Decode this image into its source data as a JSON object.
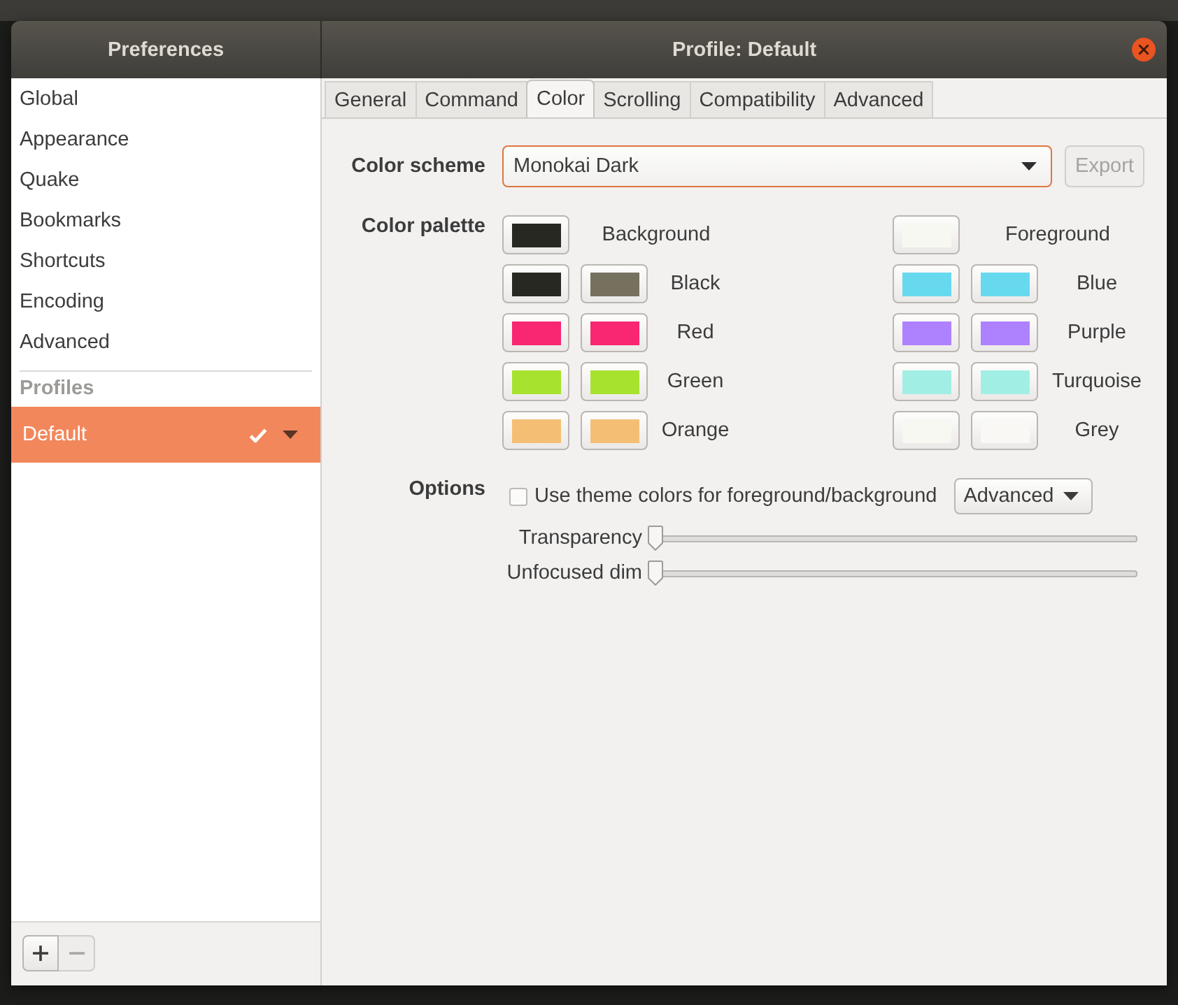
{
  "window": {
    "sidebar_title": "Preferences",
    "title": "Profile: Default"
  },
  "sidebar": {
    "items": [
      {
        "label": "Global",
        "selected": false
      },
      {
        "label": "Appearance",
        "selected": false
      },
      {
        "label": "Quake",
        "selected": false
      },
      {
        "label": "Bookmarks",
        "selected": false
      },
      {
        "label": "Shortcuts",
        "selected": false
      },
      {
        "label": "Encoding",
        "selected": false
      },
      {
        "label": "Advanced",
        "selected": false
      }
    ],
    "section_title": "Profiles",
    "profiles": [
      {
        "label": "Default",
        "selected": true,
        "default": true
      }
    ],
    "toolbar": [
      {
        "kind": "add",
        "disabled": false
      },
      {
        "kind": "remove",
        "disabled": true
      }
    ]
  },
  "tabs": [
    {
      "label": "General",
      "selected": false
    },
    {
      "label": "Command",
      "selected": false
    },
    {
      "label": "Color",
      "selected": true
    },
    {
      "label": "Scrolling",
      "selected": false
    },
    {
      "label": "Compatibility",
      "selected": false
    },
    {
      "label": "Advanced",
      "selected": false
    }
  ],
  "color_scheme": {
    "label": "Color scheme",
    "value": "Monokai Dark",
    "focused": true,
    "export": {
      "label": "Export",
      "disabled": true
    }
  },
  "palette": {
    "label": "Color palette",
    "entries": [
      {
        "name": "Background",
        "swatches": [
          {
            "color": "#272822"
          }
        ]
      },
      {
        "name": "Foreground",
        "swatches": [
          {
            "color": "#f8f8f2"
          }
        ]
      },
      {
        "name": "Black",
        "swatches": [
          {
            "color": "#272822"
          },
          {
            "color": "#75715e"
          }
        ]
      },
      {
        "name": "Blue",
        "swatches": [
          {
            "color": "#66d9ef"
          },
          {
            "color": "#66d9ef"
          }
        ]
      },
      {
        "name": "Red",
        "swatches": [
          {
            "color": "#f92672"
          },
          {
            "color": "#f92672"
          }
        ]
      },
      {
        "name": "Purple",
        "swatches": [
          {
            "color": "#ae81ff"
          },
          {
            "color": "#ae81ff"
          }
        ]
      },
      {
        "name": "Green",
        "swatches": [
          {
            "color": "#a6e22e"
          },
          {
            "color": "#a6e22e"
          }
        ]
      },
      {
        "name": "Turquoise",
        "swatches": [
          {
            "color": "#a1efe4"
          },
          {
            "color": "#a1efe4"
          }
        ]
      },
      {
        "name": "Orange",
        "swatches": [
          {
            "color": "#f4bf75"
          },
          {
            "color": "#f4bf75"
          }
        ]
      },
      {
        "name": "Grey",
        "swatches": [
          {
            "color": "#f8f8f2"
          },
          {
            "color": "#f9f8f5"
          }
        ]
      }
    ]
  },
  "options": {
    "label": "Options",
    "checkbox": {
      "label": "Use theme colors for foreground/background",
      "checked": false
    },
    "menu_button": {
      "label": "Advanced"
    },
    "sliders": [
      {
        "label": "Transparency",
        "level": 0
      },
      {
        "label": "Unfocused dim",
        "level": 0
      }
    ]
  }
}
